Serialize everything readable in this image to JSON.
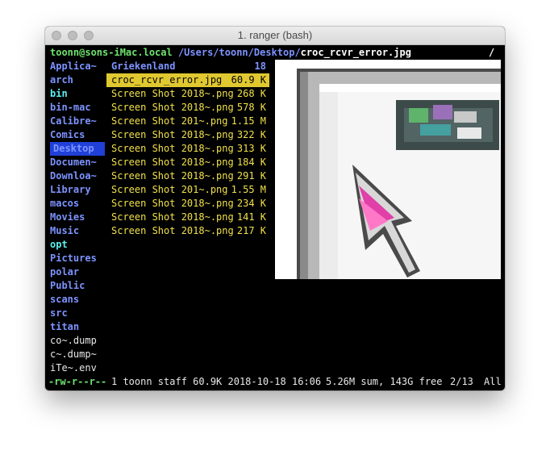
{
  "window": {
    "title": "1. ranger (bash)"
  },
  "header": {
    "user_host": "toonn@sons-iMac.local",
    "path": "/Users/toonn/Desktop/",
    "file": "croc_rcvr_error.jpg",
    "right": "/"
  },
  "parent_column": [
    {
      "name": "Applica~",
      "style": "dir"
    },
    {
      "name": "arch",
      "style": "dir"
    },
    {
      "name": "bin",
      "style": "link"
    },
    {
      "name": "bin-mac",
      "style": "dir"
    },
    {
      "name": "Calibre~",
      "style": "dir"
    },
    {
      "name": "Comics",
      "style": "dir"
    },
    {
      "name": "Desktop",
      "style": "cur"
    },
    {
      "name": "Documen~",
      "style": "dir"
    },
    {
      "name": "Downloa~",
      "style": "dir"
    },
    {
      "name": "Library",
      "style": "dir"
    },
    {
      "name": "macos",
      "style": "dir"
    },
    {
      "name": "Movies",
      "style": "dir"
    },
    {
      "name": "Music",
      "style": "dir"
    },
    {
      "name": "opt",
      "style": "link"
    },
    {
      "name": "Pictures",
      "style": "dir"
    },
    {
      "name": "polar",
      "style": "dir"
    },
    {
      "name": "Public",
      "style": "dir"
    },
    {
      "name": "scans",
      "style": "dir"
    },
    {
      "name": "src",
      "style": "dir"
    },
    {
      "name": "titan",
      "style": "dir"
    },
    {
      "name": "co~.dump",
      "style": "plain"
    },
    {
      "name": "c~.dump~",
      "style": "plain"
    },
    {
      "name": "iTe~.env",
      "style": "plain"
    }
  ],
  "current_column": [
    {
      "name": "Griekenland",
      "size": "18",
      "style": "dir"
    },
    {
      "name": "croc_rcvr_error.jpg",
      "size": "60.9 K",
      "style": "sel"
    },
    {
      "name": "Screen Shot 2018~.png",
      "size": "268 K",
      "style": "img"
    },
    {
      "name": "Screen Shot 2018~.png",
      "size": "578 K",
      "style": "img"
    },
    {
      "name": "Screen Shot 201~.png",
      "size": "1.15 M",
      "style": "img"
    },
    {
      "name": "Screen Shot 2018~.png",
      "size": "322 K",
      "style": "img"
    },
    {
      "name": "Screen Shot 2018~.png",
      "size": "313 K",
      "style": "img"
    },
    {
      "name": "Screen Shot 2018~.png",
      "size": "184 K",
      "style": "img"
    },
    {
      "name": "Screen Shot 2018~.png",
      "size": "291 K",
      "style": "img"
    },
    {
      "name": "Screen Shot 201~.png",
      "size": "1.55 M",
      "style": "img"
    },
    {
      "name": "Screen Shot 2018~.png",
      "size": "234 K",
      "style": "img"
    },
    {
      "name": "Screen Shot 2018~.png",
      "size": "141 K",
      "style": "img"
    },
    {
      "name": "Screen Shot 2018~.png",
      "size": "217 K",
      "style": "img"
    }
  ],
  "status": {
    "perms": "-rw-r--r--",
    "info": "1 toonn staff 60.9K 2018-10-18 16:06",
    "summary": "5.26M sum, 143G free",
    "position": "2/13",
    "scroll": "All"
  },
  "colors": {
    "dir": "#7d93ff",
    "link": "#5ef0f0",
    "image": "#f0e04a",
    "selection": "#e0c830",
    "current_dir_bg": "#2040d8",
    "host": "#6ee36e"
  }
}
